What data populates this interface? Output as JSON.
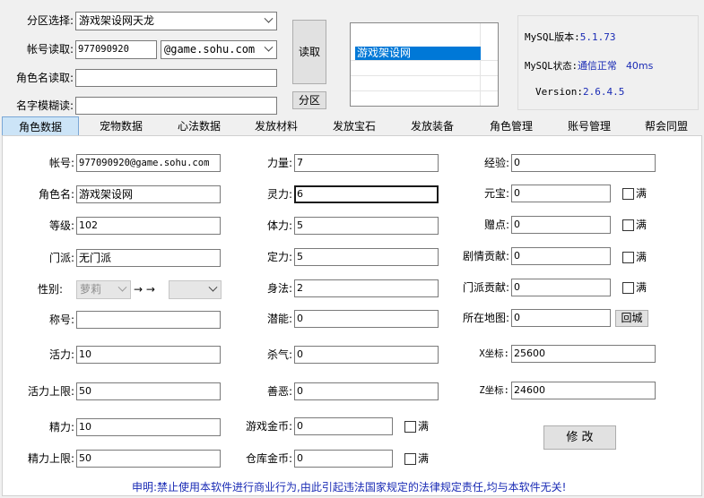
{
  "top": {
    "zone_label": "分区选择:",
    "zone_value": "游戏架设网天龙",
    "account_read_label": "帐号读取:",
    "account_value": "977090920",
    "domain_value": "@game.sohu.com",
    "role_read_label": "角色名读取:",
    "role_read_value": "",
    "fuzzy_label": "名字模糊读:",
    "fuzzy_value": "",
    "read_button": "读取",
    "zone_button": "分区",
    "list_items": [
      "游戏架设网"
    ]
  },
  "status": {
    "mysql_version_label": "MySQL版本:",
    "mysql_version_value": "5.1.73",
    "mysql_state_label": "MySQL状态:",
    "mysql_state_value": "通信正常",
    "mysql_latency": "40ms",
    "version_label": "Version:",
    "version_value": "2.6.4.5"
  },
  "tabs": [
    "角色数据",
    "宠物数据",
    "心法数据",
    "发放材料",
    "发放宝石",
    "发放装备",
    "角色管理",
    "账号管理",
    "帮会同盟"
  ],
  "form": {
    "account_label": "帐号:",
    "account_value": "977090920@game.sohu.com",
    "role_label": "角色名:",
    "role_value": "游戏架设网",
    "level_label": "等级:",
    "level_value": "102",
    "sect_label": "门派:",
    "sect_value": "无门派",
    "gender_label": "性别:",
    "gender_value": "萝莉",
    "gender_arrow": "→ →",
    "gender_target": "",
    "title_label": "称号:",
    "title_value": "",
    "vigor_label": "活力:",
    "vigor_value": "10",
    "vigor_max_label": "活力上限:",
    "vigor_max_value": "50",
    "energy_label": "精力:",
    "energy_value": "10",
    "energy_max_label": "精力上限:",
    "energy_max_value": "50",
    "str_label": "力量:",
    "str_value": "7",
    "spi_label": "灵力:",
    "spi_value": "6",
    "con_label": "体力:",
    "con_value": "5",
    "sta_label": "定力:",
    "sta_value": "5",
    "dex_label": "身法:",
    "dex_value": "2",
    "pot_label": "潜能:",
    "pot_value": "0",
    "kill_label": "杀气:",
    "kill_value": "0",
    "karma_label": "善恶:",
    "karma_value": "0",
    "gold_label": "游戏金币:",
    "gold_value": "0",
    "bank_label": "仓库金币:",
    "bank_value": "0",
    "exp_label": "经验:",
    "exp_value": "0",
    "yuanbao_label": "元宝:",
    "yuanbao_value": "0",
    "gift_label": "赠点:",
    "gift_value": "0",
    "story_label": "剧情贡献:",
    "story_value": "0",
    "sectc_label": "门派贡献:",
    "sectc_value": "0",
    "map_label": "所在地图:",
    "map_value": "0",
    "return_city": "回城",
    "x_label": "X坐标:",
    "x_value": "25600",
    "z_label": "Z坐标:",
    "z_value": "24600",
    "full_label": "满",
    "modify_button": "修 改"
  },
  "footer": {
    "disclaimer": "申明:禁止使用本软件进行商业行为,由此引起违法国家规定的法律规定责任,均与本软件无关!"
  },
  "colors": {
    "accent_blue": "#1a2bb5",
    "selected_bg": "#0078d7",
    "tab_active": "#cce4f7"
  }
}
